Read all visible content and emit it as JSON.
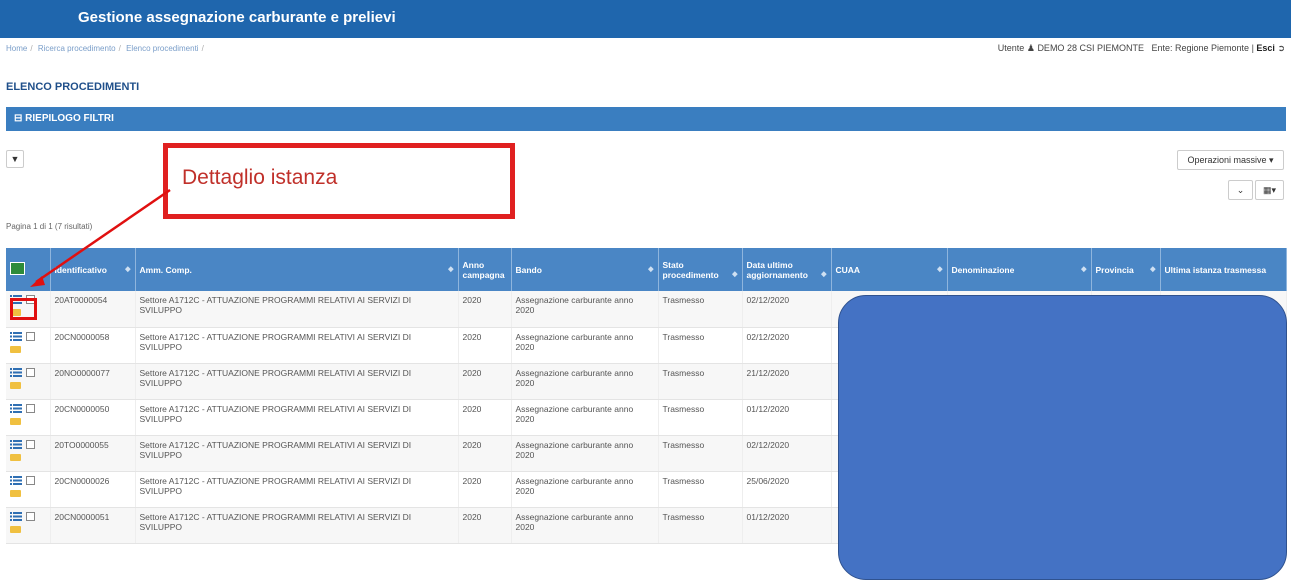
{
  "app": {
    "title": "Gestione assegnazione carburante e prelievi"
  },
  "breadcrumb": [
    "Home",
    "Ricerca procedimento",
    "Elenco procedimenti"
  ],
  "user": {
    "label": "Utente",
    "name": "DEMO 28 CSI PIEMONTE",
    "ente_label": "Ente:",
    "ente": "Regione Piemonte",
    "exit": "Esci"
  },
  "page": {
    "heading": "ELENCO PROCEDIMENTI"
  },
  "filters": {
    "label": "RIEPILOGO FILTRI",
    "filter_icon": "filter-icon"
  },
  "toolbar": {
    "operations_label": "Operazioni massive"
  },
  "callout": {
    "text": "Dettaglio istanza"
  },
  "pager": {
    "text": "Pagina 1 di 1 (7 risultati)"
  },
  "table": {
    "headers": [
      "",
      "Identificativo",
      "Amm. Comp.",
      "Anno campagna",
      "Bando",
      "Stato procedimento",
      "Data ultimo aggiornamento",
      "CUAA",
      "Denominazione",
      "Provincia",
      "Ultima istanza trasmessa"
    ],
    "rows": [
      {
        "id": "20AT0000054",
        "amm": "Settore A1712C - ATTUAZIONE PROGRAMMI RELATIVI AI SERVIZI DI SVILUPPO",
        "anno": "2020",
        "bando": "Assegnazione carburante anno 2020",
        "stato": "Trasmesso",
        "data": "02/12/2020"
      },
      {
        "id": "20CN0000058",
        "amm": "Settore A1712C - ATTUAZIONE PROGRAMMI RELATIVI AI SERVIZI DI SVILUPPO",
        "anno": "2020",
        "bando": "Assegnazione carburante anno 2020",
        "stato": "Trasmesso",
        "data": "02/12/2020"
      },
      {
        "id": "20NO0000077",
        "amm": "Settore A1712C - ATTUAZIONE PROGRAMMI RELATIVI AI SERVIZI DI SVILUPPO",
        "anno": "2020",
        "bando": "Assegnazione carburante anno 2020",
        "stato": "Trasmesso",
        "data": "21/12/2020"
      },
      {
        "id": "20CN0000050",
        "amm": "Settore A1712C - ATTUAZIONE PROGRAMMI RELATIVI AI SERVIZI DI SVILUPPO",
        "anno": "2020",
        "bando": "Assegnazione carburante anno 2020",
        "stato": "Trasmesso",
        "data": "01/12/2020"
      },
      {
        "id": "20TO0000055",
        "amm": "Settore A1712C - ATTUAZIONE PROGRAMMI RELATIVI AI SERVIZI DI SVILUPPO",
        "anno": "2020",
        "bando": "Assegnazione carburante anno 2020",
        "stato": "Trasmesso",
        "data": "02/12/2020"
      },
      {
        "id": "20CN0000026",
        "amm": "Settore A1712C - ATTUAZIONE PROGRAMMI RELATIVI AI SERVIZI DI SVILUPPO",
        "anno": "2020",
        "bando": "Assegnazione carburante anno 2020",
        "stato": "Trasmesso",
        "data": "25/06/2020"
      },
      {
        "id": "20CN0000051",
        "amm": "Settore A1712C - ATTUAZIONE PROGRAMMI RELATIVI AI SERVIZI DI SVILUPPO",
        "anno": "2020",
        "bando": "Assegnazione carburante anno 2020",
        "stato": "Trasmesso",
        "data": "01/12/2020"
      }
    ]
  },
  "colors": {
    "header_blue": "#1f66ad",
    "table_header": "#4a86c5",
    "callout_red": "#e02020",
    "redaction": "#4472c4"
  }
}
